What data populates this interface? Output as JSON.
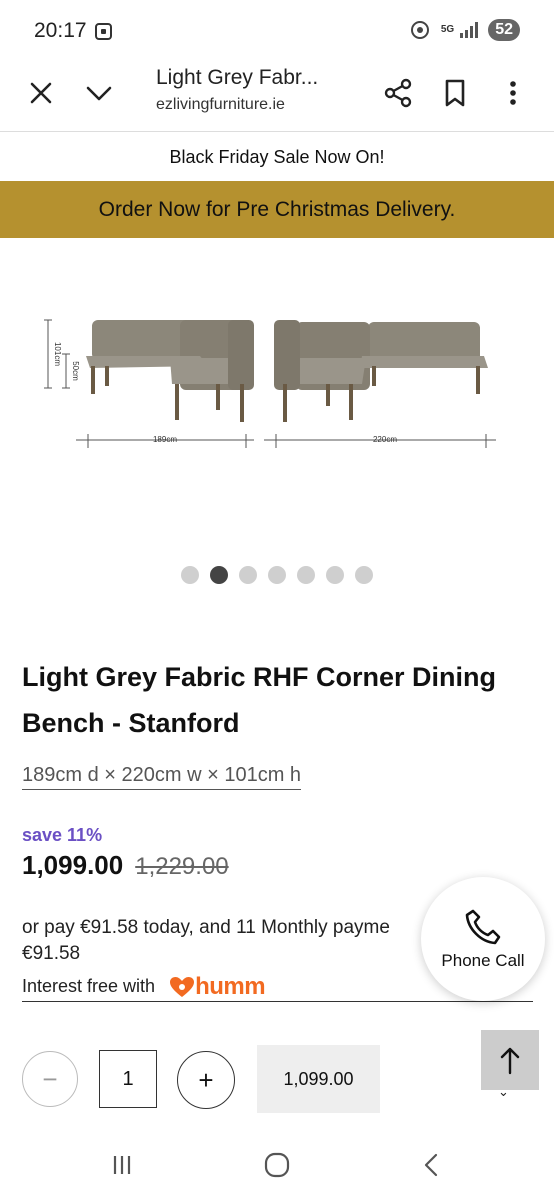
{
  "status": {
    "time": "20:17",
    "network": "5G",
    "battery": "52"
  },
  "browser": {
    "title": "Light Grey Fabr...",
    "url": "ezlivingfurniture.ie"
  },
  "banners": {
    "sale": "Black Friday Sale Now On!",
    "order": "Order Now for Pre Christmas Delivery."
  },
  "image": {
    "dim_height": "101cm",
    "dim_seat": "50cm",
    "dim_left_width": "189cm",
    "dim_right_width": "220cm",
    "carousel_count": 7,
    "carousel_active": 2
  },
  "product": {
    "title": "Light Grey Fabric RHF Corner Dining Bench - Stanford",
    "dimensions": "189cm d × 220cm w × 101cm h",
    "save": "save 11%",
    "price": "1,099.00",
    "old_price": "1,229.00",
    "installment_line1": "or pay €91.58 today, and 11 Monthly payme",
    "installment_line2": "€91.58",
    "interest": "Interest free with",
    "humm_logo": "humm"
  },
  "phone_call": {
    "label": "Phone Call"
  },
  "cart": {
    "quantity": "1",
    "minus": "−",
    "plus": "+",
    "total": "1,099.00"
  },
  "colors": {
    "banner": "#b5912f",
    "save": "#6b50c4",
    "humm": "#f26a21"
  }
}
